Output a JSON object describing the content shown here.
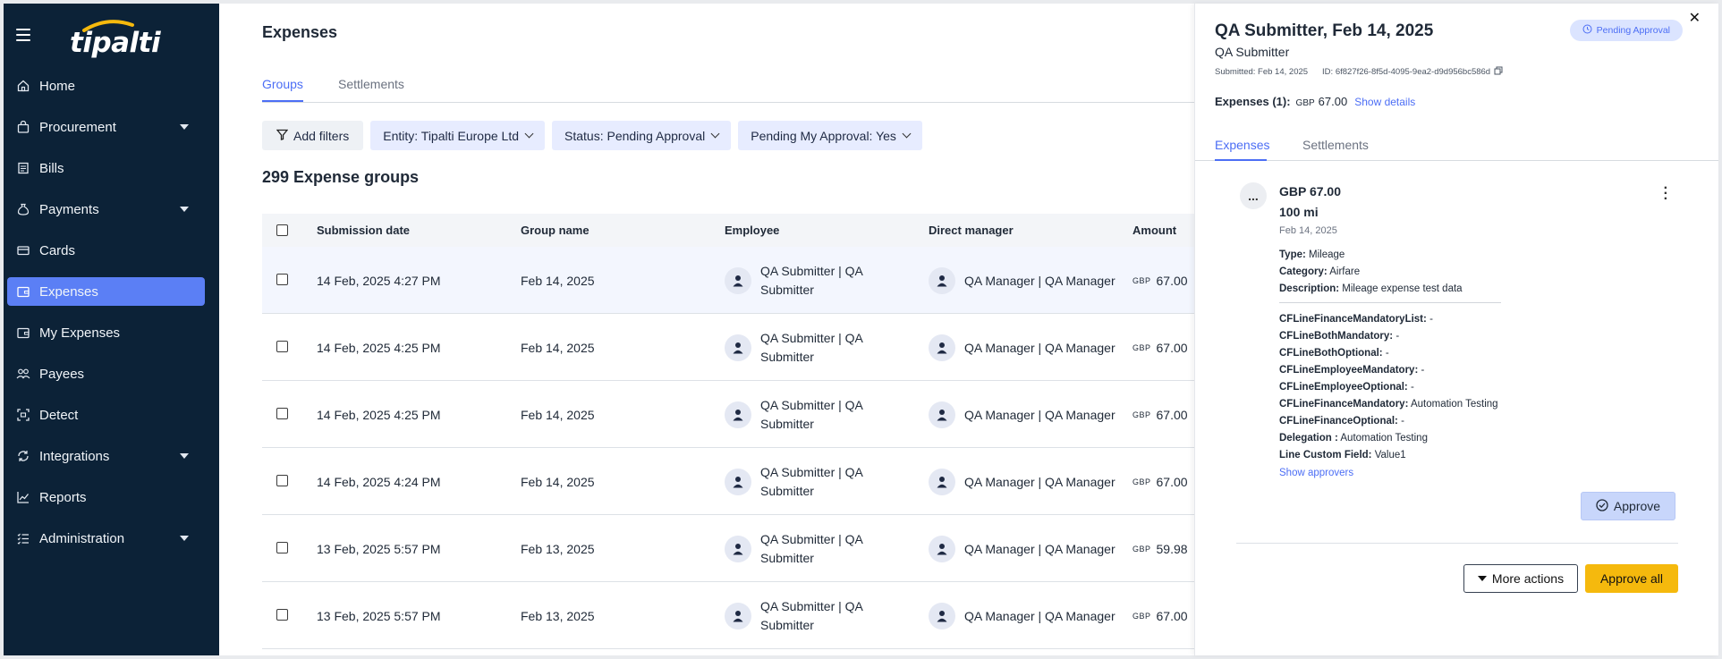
{
  "brand": {
    "logo_text": "tipalti"
  },
  "sidebar": {
    "items": [
      {
        "label": "Home",
        "icon": "home-icon"
      },
      {
        "label": "Procurement",
        "icon": "bag-icon",
        "expandable": true
      },
      {
        "label": "Bills",
        "icon": "bill-icon"
      },
      {
        "label": "Payments",
        "icon": "money-bag-icon",
        "expandable": true
      },
      {
        "label": "Cards",
        "icon": "card-icon"
      },
      {
        "label": "Expenses",
        "icon": "wallet-icon",
        "active": true
      },
      {
        "label": "My Expenses",
        "icon": "wallet-icon"
      },
      {
        "label": "Payees",
        "icon": "people-icon"
      },
      {
        "label": "Detect",
        "icon": "detect-icon"
      },
      {
        "label": "Integrations",
        "icon": "integration-icon",
        "expandable": true
      },
      {
        "label": "Reports",
        "icon": "chart-icon"
      },
      {
        "label": "Administration",
        "icon": "list-icon",
        "expandable": true
      }
    ]
  },
  "main": {
    "title": "Expenses",
    "tabs": [
      {
        "label": "Groups",
        "active": true
      },
      {
        "label": "Settlements"
      }
    ],
    "filters": {
      "add": "Add filters",
      "entity": "Entity:  Tipalti Europe Ltd",
      "status": "Status:  Pending Approval",
      "pending": "Pending My Approval:  Yes"
    },
    "count_title": "299 Expense groups",
    "table": {
      "headers": {
        "date": "Submission date",
        "group": "Group name",
        "employee": "Employee",
        "manager": "Direct manager",
        "amount": "Amount"
      },
      "rows": [
        {
          "date": "14 Feb, 2025 4:27 PM",
          "group": "Feb 14, 2025",
          "employee": "QA Submitter | QA Submitter",
          "manager": "QA Manager | QA Manager",
          "currency": "GBP",
          "amount": "67.00"
        },
        {
          "date": "14 Feb, 2025 4:25 PM",
          "group": "Feb 14, 2025",
          "employee": "QA Submitter | QA Submitter",
          "manager": "QA Manager | QA Manager",
          "currency": "GBP",
          "amount": "67.00"
        },
        {
          "date": "14 Feb, 2025 4:25 PM",
          "group": "Feb 14, 2025",
          "employee": "QA Submitter | QA Submitter",
          "manager": "QA Manager | QA Manager",
          "currency": "GBP",
          "amount": "67.00"
        },
        {
          "date": "14 Feb, 2025 4:24 PM",
          "group": "Feb 14, 2025",
          "employee": "QA Submitter | QA Submitter",
          "manager": "QA Manager | QA Manager",
          "currency": "GBP",
          "amount": "67.00"
        },
        {
          "date": "13 Feb, 2025 5:57 PM",
          "group": "Feb 13, 2025",
          "employee": "QA Submitter | QA Submitter",
          "manager": "QA Manager | QA Manager",
          "currency": "GBP",
          "amount": "59.98"
        },
        {
          "date": "13 Feb, 2025 5:57 PM",
          "group": "Feb 13, 2025",
          "employee": "QA Submitter | QA Submitter",
          "manager": "QA Manager | QA Manager",
          "currency": "GBP",
          "amount": "67.00"
        }
      ]
    }
  },
  "panel": {
    "title": "QA Submitter, Feb 14, 2025",
    "subtitle": "QA Submitter",
    "submitted": "Submitted: Feb 14, 2025",
    "id": "ID: 6f827f26-8f5d-4095-9ea2-d9d956bc586d",
    "status": "Pending Approval",
    "expenses_label": "Expenses (1):",
    "expenses_currency": "GBP",
    "expenses_amount": "67.00",
    "show_details": "Show details",
    "tabs": [
      {
        "label": "Expenses",
        "active": true
      },
      {
        "label": "Settlements"
      }
    ],
    "expense": {
      "icon_text": "...",
      "amount": "GBP 67.00",
      "distance": "100 mi",
      "date": "Feb 14, 2025",
      "fields": [
        {
          "label": "Type:",
          "value": "Mileage"
        },
        {
          "label": "Category:",
          "value": "Airfare"
        },
        {
          "label": "Description:",
          "value": "Mileage expense test data"
        }
      ],
      "custom_fields": [
        {
          "label": "CFLineFinanceMandatoryList:",
          "value": "-"
        },
        {
          "label": "CFLineBothMandatory:",
          "value": "-"
        },
        {
          "label": "CFLineBothOptional:",
          "value": "-"
        },
        {
          "label": "CFLineEmployeeMandatory:",
          "value": "-"
        },
        {
          "label": "CFLineEmployeeOptional:",
          "value": "-"
        },
        {
          "label": "CFLineFinanceMandatory:",
          "value": "Automation Testing"
        },
        {
          "label": "CFLineFinanceOptional:",
          "value": "-"
        },
        {
          "label": "Delegation :",
          "value": "Automation Testing"
        },
        {
          "label": "Line Custom Field:",
          "value": "Value1"
        }
      ],
      "show_approvers": "Show approvers"
    },
    "approve": "Approve",
    "more_actions": "More actions",
    "approve_all": "Approve all"
  },
  "colors": {
    "sidebar_bg": "#0c2237",
    "accent": "#5b7ff5",
    "approve_all": "#f5b90d",
    "link": "#4c6ef5"
  }
}
